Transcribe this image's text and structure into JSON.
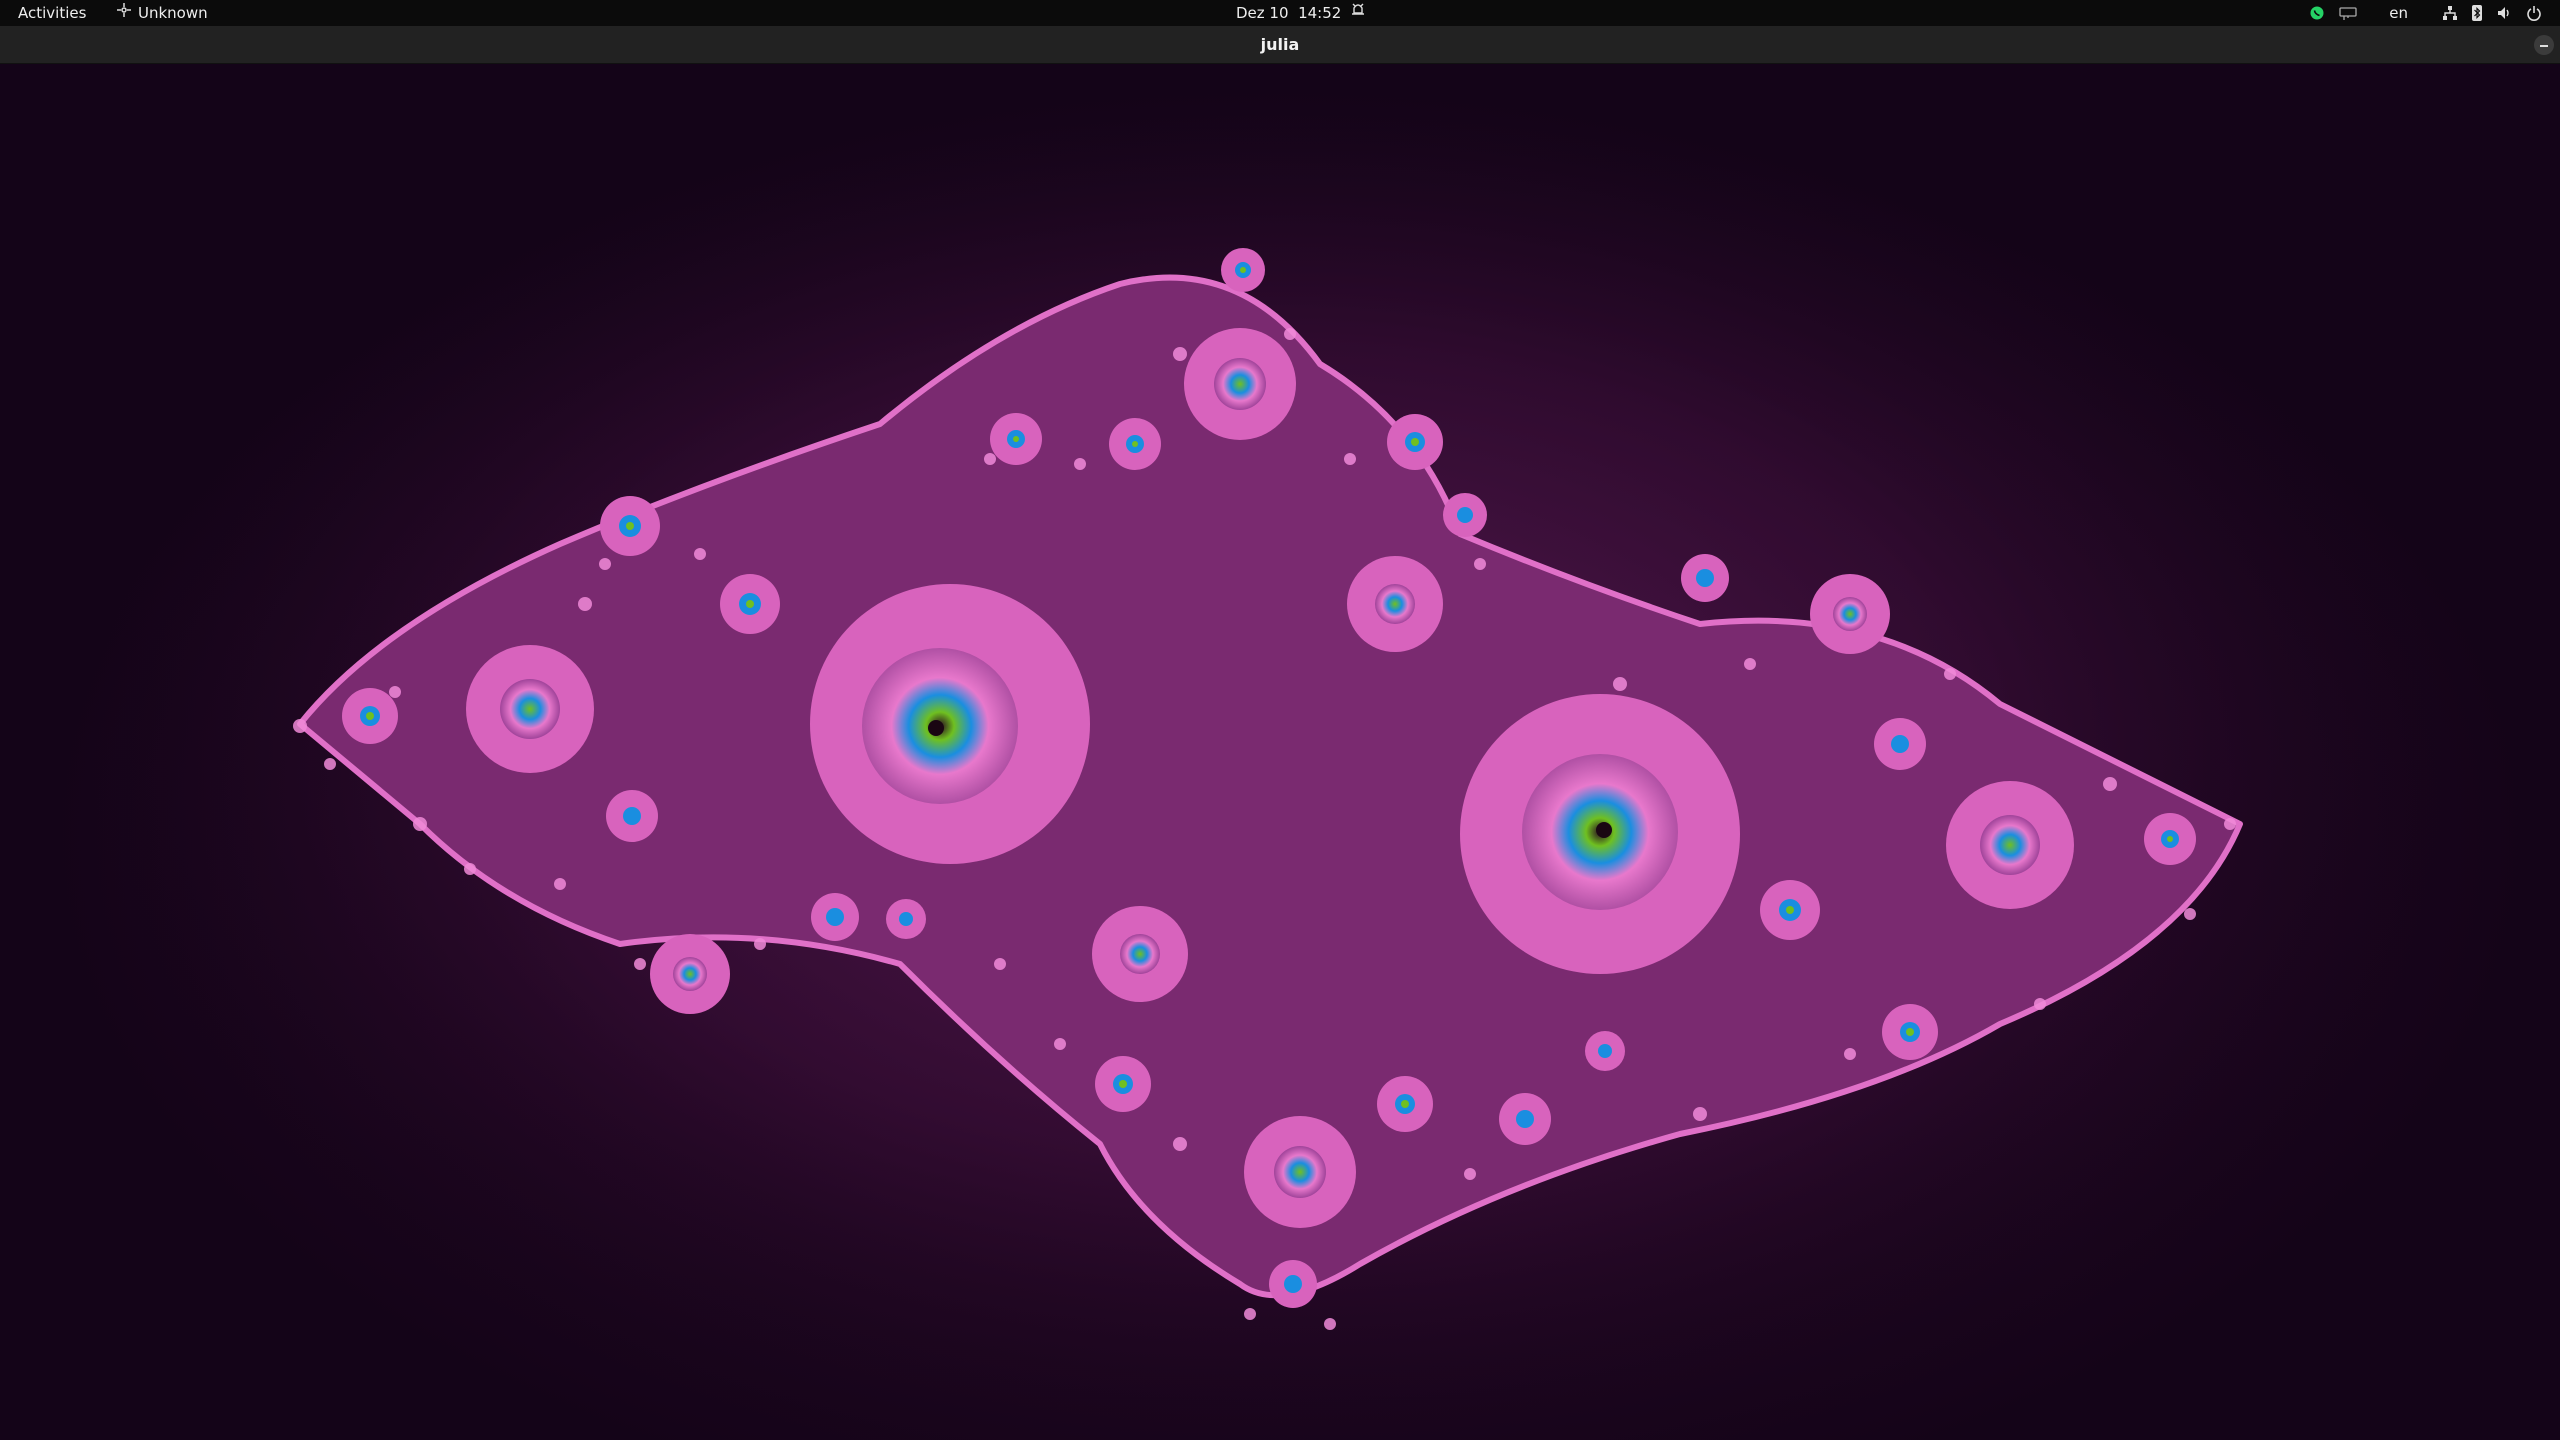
{
  "topbar": {
    "activities_label": "Activities",
    "app_name": "Unknown",
    "clock_date": "Dez 10",
    "clock_time": "14:52",
    "language": "en",
    "icons": [
      "whatsapp-icon",
      "keyboard-icon",
      "network-icon",
      "bluetooth-icon",
      "volume-icon",
      "power-icon"
    ],
    "whatsapp_color": "#25d366"
  },
  "window": {
    "title": "julia"
  },
  "colors": {
    "background_dark": "#140418",
    "fractal_pink": "#e070c8",
    "fractal_body": "#7a2a70",
    "spiral_blue": "#1a90e0",
    "spiral_green": "#70c020"
  }
}
